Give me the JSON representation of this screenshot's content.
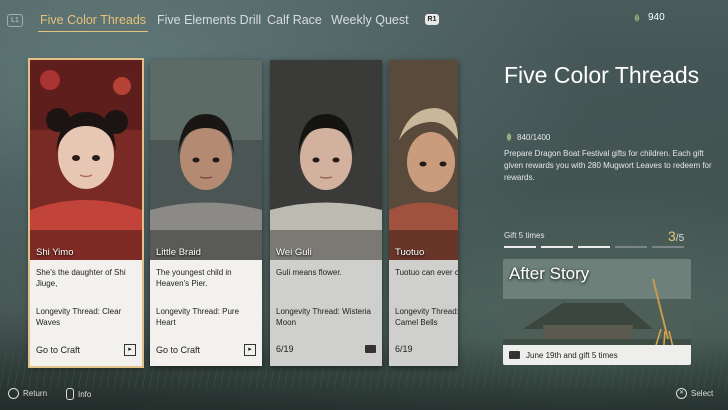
{
  "header": {
    "left_button": "L1",
    "right_button": "R1",
    "tabs": [
      {
        "label": "Five Color Threads",
        "active": true
      },
      {
        "label": "Five Elements Drill",
        "active": false
      },
      {
        "label": "Calf Race",
        "active": false
      },
      {
        "label": "Weekly Quest",
        "active": false
      }
    ],
    "currency": {
      "icon": "mugwort-leaf-icon",
      "value": "940"
    }
  },
  "cards": [
    {
      "name": "Shi Yimo",
      "desc": "She's the daughter of Shi Jiuge,",
      "thread": "Longevity Thread: Clear Waves",
      "action": "Go to Craft",
      "icon": "arrow-right-icon",
      "selected": true
    },
    {
      "name": "Little Braid",
      "desc": "The youngest child in Heaven's Pier.",
      "thread": "Longevity Thread: Pure Heart",
      "action": "Go to Craft",
      "icon": "arrow-right-icon",
      "selected": false
    },
    {
      "name": "Wei Guli",
      "desc": "Guli means flower.",
      "thread": "Longevity Thread: Wisteria Moon",
      "action": "6/19",
      "icon": "gift-icon",
      "selected": false
    },
    {
      "name": "Tuotuo",
      "desc": "Tuotuo can ever camels.",
      "thread": "Longevity Thread: Camel Bells",
      "action": "6/19",
      "icon": "gift-icon",
      "selected": false
    }
  ],
  "panel": {
    "title": "Five Color Threads",
    "progress": "840/1400",
    "description": "Prepare Dragon Boat Festival gifts for children. Each gift given rewards you with 280 Mugwort Leaves to redeem for rewards.",
    "gift_label": "Gift 5 times",
    "gift_current": "3",
    "gift_total": "/5",
    "after_story": {
      "title": "After Story",
      "note": "June 19th and gift 5 times"
    }
  },
  "footer": {
    "return": "Return",
    "info": "Info",
    "select": "Select"
  },
  "colors": {
    "accent": "#e7c27a",
    "card_info": "#f2f1ee"
  }
}
